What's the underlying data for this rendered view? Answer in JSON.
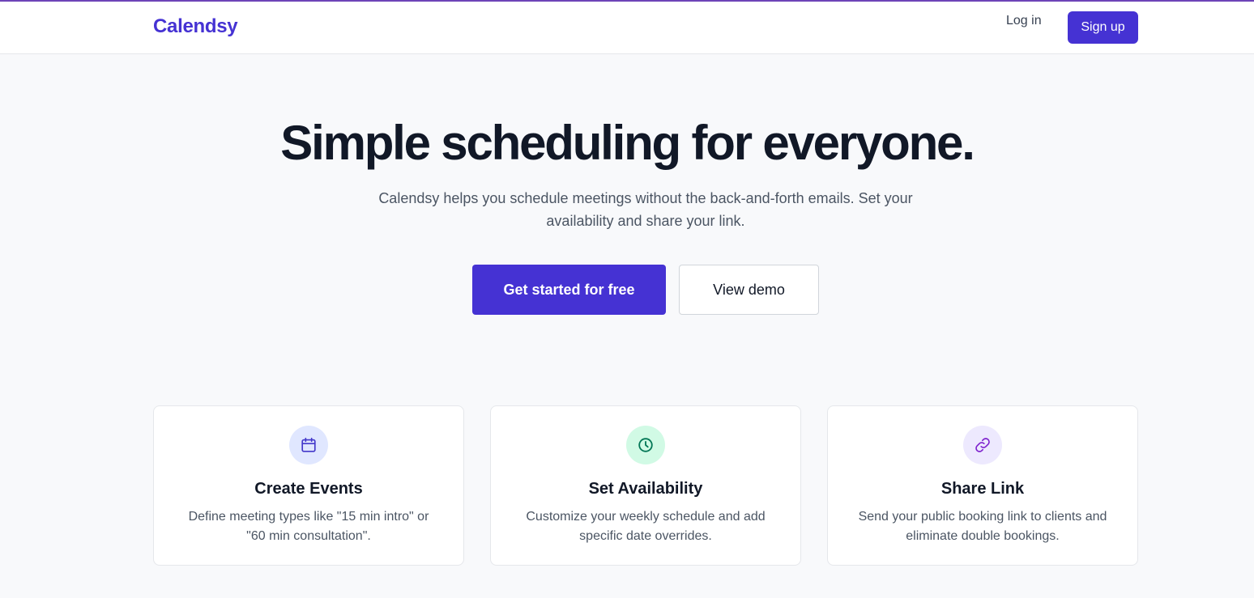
{
  "header": {
    "logo": "Calendsy",
    "login_label": "Log in",
    "signup_label": "Sign up"
  },
  "hero": {
    "title": "Simple scheduling for everyone.",
    "subtitle": "Calendsy helps you schedule meetings without the back-and-forth emails. Set your availability and share your link.",
    "primary_cta": "Get started for free",
    "secondary_cta": "View demo"
  },
  "features": [
    {
      "icon": "calendar-icon",
      "title": "Create Events",
      "description": "Define meeting types like \"15 min intro\" or \"60 min consultation\".",
      "icon_bg": "#e0e7ff",
      "icon_color": "#4338ca"
    },
    {
      "icon": "clock-icon",
      "title": "Set Availability",
      "description": "Customize your weekly schedule and add specific date overrides.",
      "icon_bg": "#d1fae5",
      "icon_color": "#047857"
    },
    {
      "icon": "link-icon",
      "title": "Share Link",
      "description": "Send your public booking link to clients and eliminate double bookings.",
      "icon_bg": "#ede9fe",
      "icon_color": "#7e22ce"
    }
  ],
  "colors": {
    "brand": "#4532d3",
    "top_accent": "#6d43b8",
    "background": "#f8f9fb"
  }
}
